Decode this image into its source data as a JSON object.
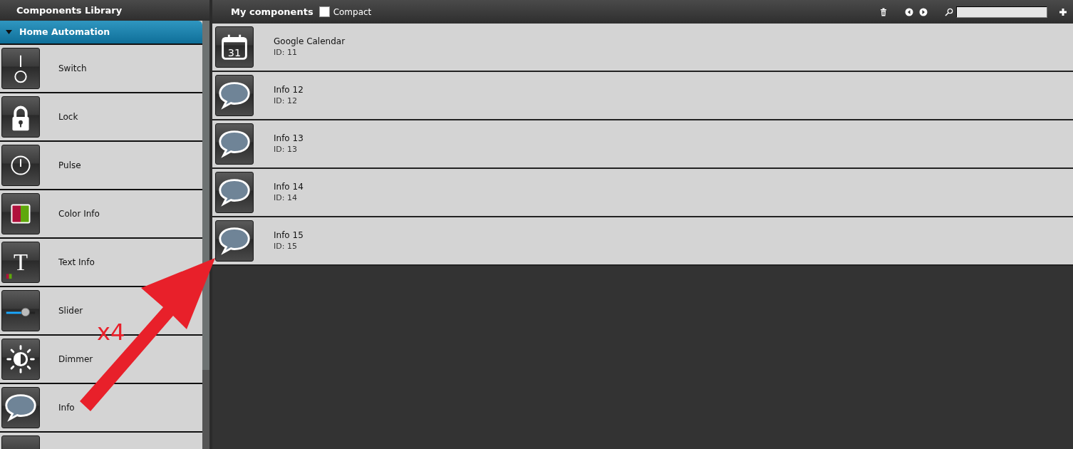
{
  "left_panel": {
    "title": "Components Library",
    "category": {
      "label": "Home Automation",
      "expanded": true
    },
    "items": [
      {
        "kind": "switch",
        "label": "Switch"
      },
      {
        "kind": "lock",
        "label": "Lock"
      },
      {
        "kind": "pulse",
        "label": "Pulse"
      },
      {
        "kind": "color",
        "label": "Color Info"
      },
      {
        "kind": "text",
        "glyph": "T",
        "label": "Text Info"
      },
      {
        "kind": "slider",
        "label": "Slider"
      },
      {
        "kind": "dimmer",
        "label": "Dimmer"
      },
      {
        "kind": "info",
        "label": "Info"
      },
      {
        "kind": "blank"
      }
    ]
  },
  "right_panel": {
    "title": "My components",
    "compact": {
      "label": "Compact",
      "checked": false
    },
    "components": [
      {
        "kind": "calendar",
        "glyph": "31",
        "name": "Google Calendar",
        "id_text": "ID: 11"
      },
      {
        "kind": "info",
        "name": "Info 12",
        "id_text": "ID: 12"
      },
      {
        "kind": "info",
        "name": "Info 13",
        "id_text": "ID: 13"
      },
      {
        "kind": "info",
        "name": "Info 14",
        "id_text": "ID: 14"
      },
      {
        "kind": "info",
        "name": "Info 15",
        "id_text": "ID: 15"
      }
    ]
  },
  "annotation": {
    "label": "x4"
  }
}
